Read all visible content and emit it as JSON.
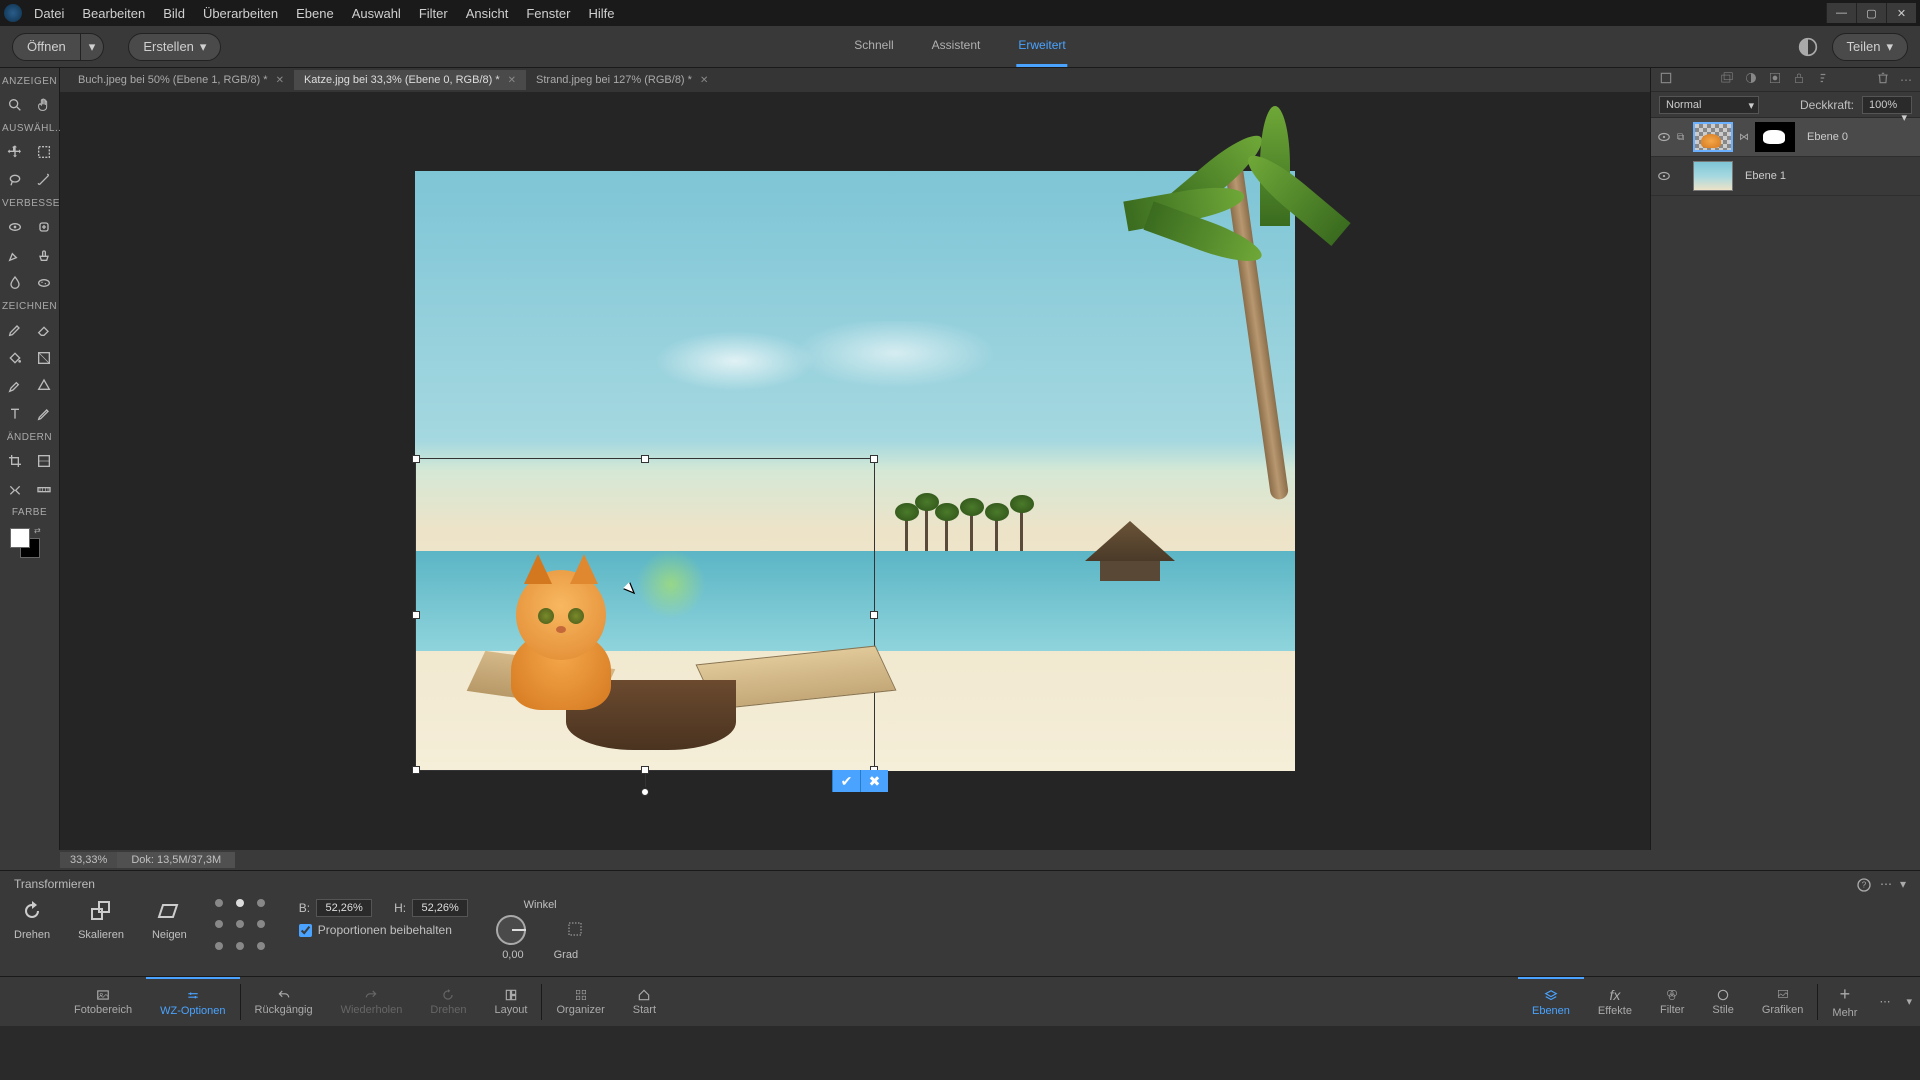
{
  "menu": [
    "Datei",
    "Bearbeiten",
    "Bild",
    "Überarbeiten",
    "Ebene",
    "Auswahl",
    "Filter",
    "Ansicht",
    "Fenster",
    "Hilfe"
  ],
  "actionbar": {
    "open": "Öffnen",
    "create": "Erstellen",
    "share": "Teilen"
  },
  "modes": {
    "quick": "Schnell",
    "guided": "Assistent",
    "expert": "Erweitert"
  },
  "doctabs": [
    {
      "label": "Buch.jpeg bei 50% (Ebene 1, RGB/8) *"
    },
    {
      "label": "Katze.jpg bei 33,3% (Ebene 0, RGB/8) *",
      "active": true
    },
    {
      "label": "Strand.jpeg bei 127% (RGB/8) *"
    }
  ],
  "toolsections": {
    "view": "ANZEIGEN",
    "select": "AUSWÄHL...",
    "enhance": "VERBESSE...",
    "draw": "ZEICHNEN",
    "modify": "ÄNDERN",
    "color": "FARBE"
  },
  "status": {
    "zoom": "33,33%",
    "doc": "Dok: 13,5M/37,3M"
  },
  "options": {
    "title": "Transformieren",
    "rotate": "Drehen",
    "scale": "Skalieren",
    "skew": "Neigen",
    "wlabel": "B:",
    "hlabel": "H:",
    "wval": "52,26%",
    "hval": "52,26%",
    "constrain": "Proportionen beibehalten",
    "anglelabel": "Winkel",
    "angleval": "0,00",
    "angleunit": "Grad"
  },
  "bottom": {
    "photobin": "Fotobereich",
    "toolopts": "WZ-Optionen",
    "undo": "Rückgängig",
    "redo": "Wiederholen",
    "rotate": "Drehen",
    "layout": "Layout",
    "organizer": "Organizer",
    "home": "Start",
    "layers": "Ebenen",
    "effects": "Effekte",
    "styles": "Stile",
    "filters": "Filter",
    "graphics": "Grafiken",
    "more": "Mehr"
  },
  "layers": {
    "blendmode": "Normal",
    "opacitylabel": "Deckkraft:",
    "opacityval": "100%",
    "items": [
      {
        "name": "Ebene 0"
      },
      {
        "name": "Ebene 1"
      }
    ]
  }
}
